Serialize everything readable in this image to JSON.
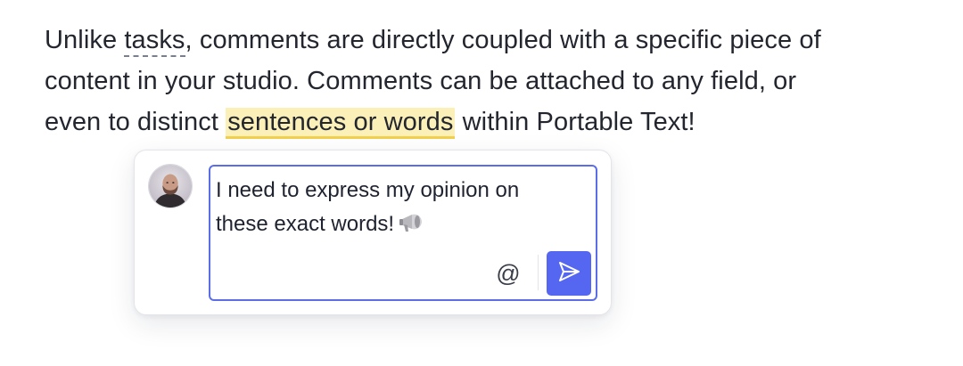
{
  "paragraph": {
    "line1_before": "Unlike ",
    "line1_link": "tasks",
    "line1_after": ", comments are directly coupled with a specific piece of",
    "line2": "content in your studio. Comments can be attached to any field, or",
    "line3_before": "even to distinct ",
    "line3_highlight": "sentences or words",
    "line3_after": " within Portable Text!"
  },
  "comment": {
    "avatar_icon": "user-avatar",
    "input_line1": "I need to express my opinion on",
    "input_line2": "these exact words!",
    "emoji_icon": "megaphone-icon",
    "mention_label": "@",
    "send_icon": "send-icon"
  },
  "colors": {
    "accent": "#5566f0",
    "input_border": "#5b6ee8",
    "highlight_bg": "#fbf0b8",
    "highlight_underline": "#f2cf4c"
  }
}
